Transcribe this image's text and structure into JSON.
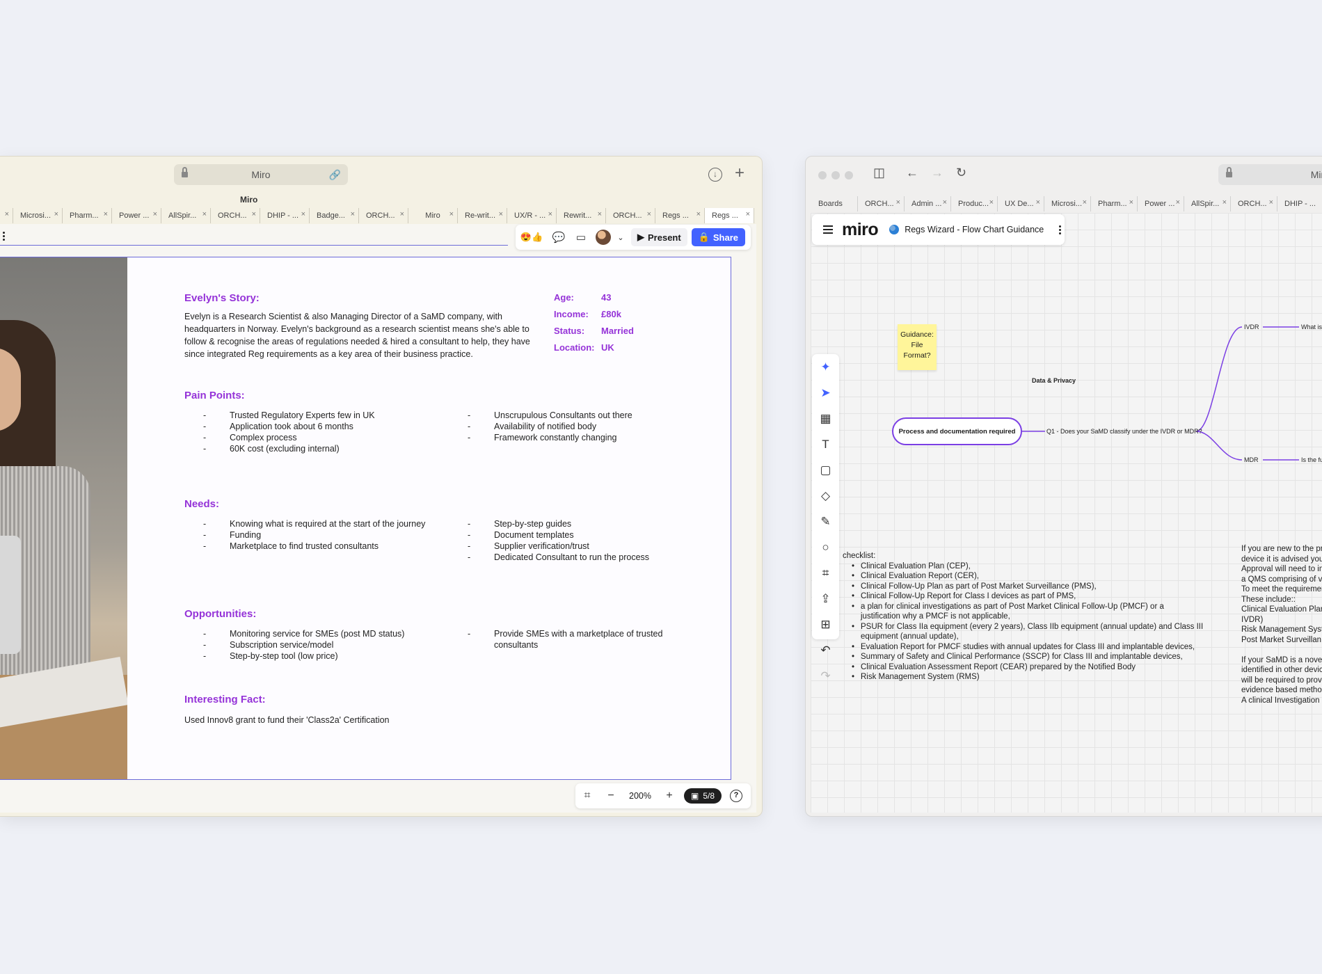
{
  "left_window": {
    "address": "Miro",
    "window_title": "Miro",
    "tabs": [
      "Microsi...",
      "Pharm...",
      "Power ...",
      "AllSpir...",
      "ORCH...",
      "DHIP - ...",
      "Badge...",
      "ORCH...",
      "Miro",
      "Re-writ...",
      "UX/R - ...",
      "Rewrit...",
      "ORCH...",
      "Regs ...",
      "Regs ..."
    ],
    "toolbar": {
      "reactions": "😍👍",
      "present_label": "Present",
      "share_label": "Share"
    },
    "slide": {
      "story_heading": "Evelyn's Story:",
      "story_text": "Evelyn is a Research Scientist & also Managing Director of a SaMD company, with headquarters in Norway. Evelyn's background as a research scientist means she's able to follow & recognise the areas of regulations needed & hired a consultant to help, they have since integrated Reg requirements as a key area of their business practice.",
      "facts": [
        {
          "label": "Age:",
          "value": "43"
        },
        {
          "label": "Income:",
          "value": "£80k"
        },
        {
          "label": "Status:",
          "value": "Married"
        },
        {
          "label": "Location:",
          "value": "UK"
        }
      ],
      "pain_heading": "Pain Points:",
      "pain_left": [
        "Trusted Regulatory Experts few in UK",
        "Application took about 6 months",
        "Complex process",
        "60K cost (excluding internal)"
      ],
      "pain_right": [
        "Unscrupulous Consultants out there",
        "Availability of notified body",
        "Framework constantly changing"
      ],
      "needs_heading": "Needs:",
      "needs_left": [
        "Knowing what is required at the start of the journey",
        "Funding",
        "Marketplace to find trusted consultants"
      ],
      "needs_right": [
        "Step-by-step guides",
        "Document templates",
        "Supplier verification/trust",
        "Dedicated Consultant to run the process"
      ],
      "opp_heading": "Opportunities:",
      "opp_left": [
        "Monitoring service for SMEs (post MD status)",
        "Subscription service/model",
        "Step-by-step tool (low price)"
      ],
      "opp_right": [
        "Provide SMEs with a  marketplace of trusted consultants"
      ],
      "fact_heading": "Interesting Fact:",
      "fact_text": "Used Innov8 grant to fund their 'Class2a' Certification"
    },
    "bottom": {
      "zoom": "200%",
      "pager": "5/8",
      "help": "?"
    }
  },
  "right_window": {
    "address": "Miro",
    "tabs": [
      "Boards",
      "ORCH...",
      "Admin ...",
      "Produc...",
      "UX De...",
      "Microsi...",
      "Pharm...",
      "Power ...",
      "AllSpir...",
      "ORCH...",
      "DHIP - ..."
    ],
    "logo": "miro",
    "board_title": "Regs Wizard - Flow Chart Guidance",
    "canvas": {
      "sticky": "Guidance: File Format?",
      "data_privacy": "Data & Privacy",
      "process_pill": "Process and documentation required",
      "q1": "Q1 - Does your SaMD classify under the IVDR or MDR?",
      "ivdr": "IVDR",
      "ivdr_next": "What is t",
      "mdr": "MDR",
      "mdr_next": "Is the fun",
      "checklist_heading": "checklist:",
      "checklist": [
        "Clinical Evaluation Plan (CEP),",
        "Clinical Evaluation Report (CER),",
        "Clinical Follow-Up Plan as part of Post Market Surveillance (PMS),",
        "Clinical Follow-Up Report for Class I devices as part of PMS,",
        "a plan for clinical investigations as part of Post Market Clinical Follow-Up (PMCF) or a justification why a PMCF is not applicable,",
        "PSUR for Class IIa equipment (every 2 years), Class IIb equipment (annual update) and Class III equipment (annual update),",
        "Evaluation Report for PMCF studies with annual updates for Class III and implantable devices,",
        "Summary of Safety and Clinical Performance (SSCP) for Class III and implantable devices,",
        "Clinical Evaluation Assessment Report (CEAR) prepared by the Notified Body",
        "Risk Management System (RMS)"
      ],
      "right_text": [
        "If you are new to the pr",
        "device it is advised you",
        "Approval will need to in",
        "a QMS comprising of v",
        "To meet the requiremer",
        "These include::",
        "Clinical Evaluation Plar",
        "IVDR)",
        "Risk Management Syst",
        "Post Market Surveillan",
        "",
        "If your SaMD is a novel",
        "identified in other devic",
        "will be required to prov",
        "evidence based metho",
        "A clinical Investigation"
      ]
    }
  }
}
